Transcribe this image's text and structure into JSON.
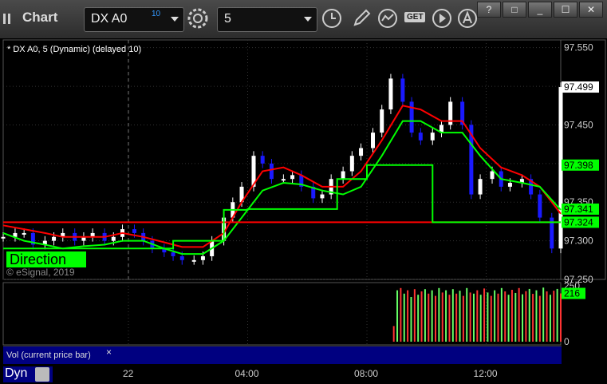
{
  "app": {
    "title": "Chart",
    "symbol": "DX A0",
    "symbol_sup": "10",
    "interval": "5",
    "get_label": "GET",
    "window_buttons": [
      "?",
      "□",
      "_",
      "☐",
      "✕"
    ]
  },
  "legend": "* DX A0, 5 (Dynamic) (delayed 10)",
  "direction_label": "Direction",
  "watermark": "© eSignal, 2019",
  "volume_pane_label": "Vol (current price bar)",
  "volume_close": "×",
  "mode_label": "Dyn",
  "colors": {
    "up_candle": "#ffffff",
    "down_candle": "#1a1aff",
    "red_line": "#ff0000",
    "green_line": "#00ff00",
    "price_tag_green": "#00ff00",
    "price_tag_white": "#ffffff"
  },
  "chart_data": [
    {
      "type": "line",
      "title": "",
      "ylim": [
        97.25,
        97.56
      ],
      "yticks": [
        97.55,
        97.5,
        97.45,
        97.4,
        97.35,
        97.3,
        97.25
      ],
      "ytick_labels": [
        "97.550",
        "97.450",
        "97.350",
        "97.300",
        "97.250"
      ],
      "xtick_labels": [
        "22",
        "04:00",
        "08:00",
        "12:00"
      ],
      "x_hours": [
        0,
        4,
        8,
        12
      ],
      "x_range_hours": [
        -4.2,
        14.5
      ],
      "price_tags": [
        {
          "label": "97.499",
          "value": 97.499,
          "style": "white"
        },
        {
          "label": "97.398",
          "value": 97.398,
          "style": "green"
        },
        {
          "label": "97.341",
          "value": 97.341,
          "style": "green"
        },
        {
          "label": "97.324",
          "value": 97.324,
          "style": "green"
        }
      ],
      "series": [
        {
          "kind": "close",
          "x": [
            -4.2,
            -3.8,
            -3.5,
            -3.2,
            -2.8,
            -2.5,
            -2.2,
            -1.8,
            -1.5,
            -1.2,
            -0.8,
            -0.5,
            -0.2,
            0.2,
            0.5,
            0.8,
            1.2,
            1.5,
            1.8,
            2.2,
            2.5,
            2.8,
            3.2,
            3.5,
            3.8,
            4.2,
            4.5,
            4.8,
            5.2,
            5.5,
            5.8,
            6.2,
            6.5,
            6.8,
            7.2,
            7.5,
            7.8,
            8.2,
            8.5,
            8.8,
            9.2,
            9.5,
            9.8,
            10.2,
            10.5,
            10.8,
            11.2,
            11.5,
            11.8,
            12.2,
            12.5,
            12.8,
            13.2,
            13.5,
            13.8,
            14.2,
            14.5
          ],
          "y": [
            97.305,
            97.31,
            97.31,
            97.295,
            97.3,
            97.305,
            97.31,
            97.3,
            97.305,
            97.31,
            97.3,
            97.305,
            97.315,
            97.31,
            97.3,
            97.29,
            97.285,
            97.28,
            97.275,
            97.275,
            97.28,
            97.3,
            97.33,
            97.35,
            97.37,
            97.41,
            97.4,
            97.38,
            97.38,
            97.385,
            97.37,
            97.355,
            97.36,
            97.38,
            97.39,
            97.41,
            97.42,
            97.44,
            97.47,
            97.51,
            97.48,
            97.44,
            97.43,
            97.44,
            97.45,
            97.48,
            97.45,
            97.36,
            97.38,
            97.39,
            97.37,
            97.375,
            97.38,
            97.36,
            97.33,
            97.29,
            97.499
          ]
        },
        {
          "name": "",
          "kind": "red",
          "x": [
            -4.2,
            -3.5,
            -2.8,
            -2.2,
            -1.5,
            -0.8,
            -0.2,
            0.5,
            1.2,
            1.8,
            2.5,
            3.2,
            3.8,
            4.5,
            5.2,
            5.8,
            6.5,
            7.2,
            7.8,
            8.5,
            9.2,
            9.8,
            10.5,
            11.2,
            11.8,
            12.5,
            13.2,
            13.8,
            14.5
          ],
          "y": [
            97.32,
            97.315,
            97.31,
            97.305,
            97.305,
            97.305,
            97.31,
            97.305,
            97.298,
            97.292,
            97.292,
            97.31,
            97.35,
            97.39,
            97.395,
            97.385,
            97.37,
            97.37,
            97.39,
            97.43,
            97.475,
            97.47,
            97.455,
            97.455,
            97.42,
            97.395,
            97.385,
            97.37,
            97.335
          ]
        },
        {
          "name": "",
          "kind": "green",
          "x": [
            -4.2,
            -3.5,
            -2.8,
            -2.2,
            -1.5,
            -0.8,
            -0.2,
            0.5,
            1.2,
            1.8,
            2.5,
            3.2,
            3.8,
            4.5,
            5.2,
            5.8,
            6.5,
            7.2,
            7.8,
            8.5,
            9.2,
            9.8,
            10.5,
            11.2,
            11.8,
            12.5,
            13.2,
            13.8,
            14.5
          ],
          "y": [
            97.31,
            97.3,
            97.295,
            97.29,
            97.293,
            97.295,
            97.3,
            97.3,
            97.29,
            97.283,
            97.283,
            97.3,
            97.33,
            97.365,
            97.375,
            97.373,
            97.365,
            97.36,
            97.37,
            97.41,
            97.455,
            97.455,
            97.44,
            97.44,
            97.41,
            97.38,
            97.375,
            97.37,
            97.34
          ]
        },
        {
          "name": "",
          "kind": "red_step",
          "x": [
            -4.2,
            14.5
          ],
          "y": [
            97.324,
            97.324
          ]
        },
        {
          "name": "",
          "kind": "green_step",
          "x": [
            -4.2,
            1.5,
            1.5,
            3.2,
            3.2,
            4.0,
            4.0,
            7.0,
            7.0,
            8.0,
            8.0,
            10.2,
            10.2,
            14.5
          ],
          "y": [
            97.29,
            97.29,
            97.3,
            97.3,
            97.34,
            97.34,
            97.341,
            97.341,
            97.38,
            97.38,
            97.398,
            97.398,
            97.324,
            97.324
          ]
        }
      ]
    },
    {
      "type": "bar",
      "title": "",
      "ylim": [
        0,
        250
      ],
      "ytick_labels": [
        "250",
        "0"
      ],
      "yticks": [
        250,
        0
      ],
      "current_label": "216",
      "current_value": 216,
      "x_start_hours": 8.9,
      "x_end_hours": 14.5,
      "values": [
        70,
        230,
        240,
        215,
        230,
        200,
        235,
        210,
        225,
        235,
        215,
        230,
        205,
        240,
        220,
        230,
        210,
        235,
        215,
        228,
        205,
        240,
        220,
        215,
        230,
        210,
        238,
        220,
        205,
        230,
        215,
        240,
        225,
        210,
        232,
        218,
        240,
        212,
        226,
        236,
        214,
        230,
        205,
        242,
        225,
        210,
        228,
        236,
        216
      ]
    }
  ]
}
